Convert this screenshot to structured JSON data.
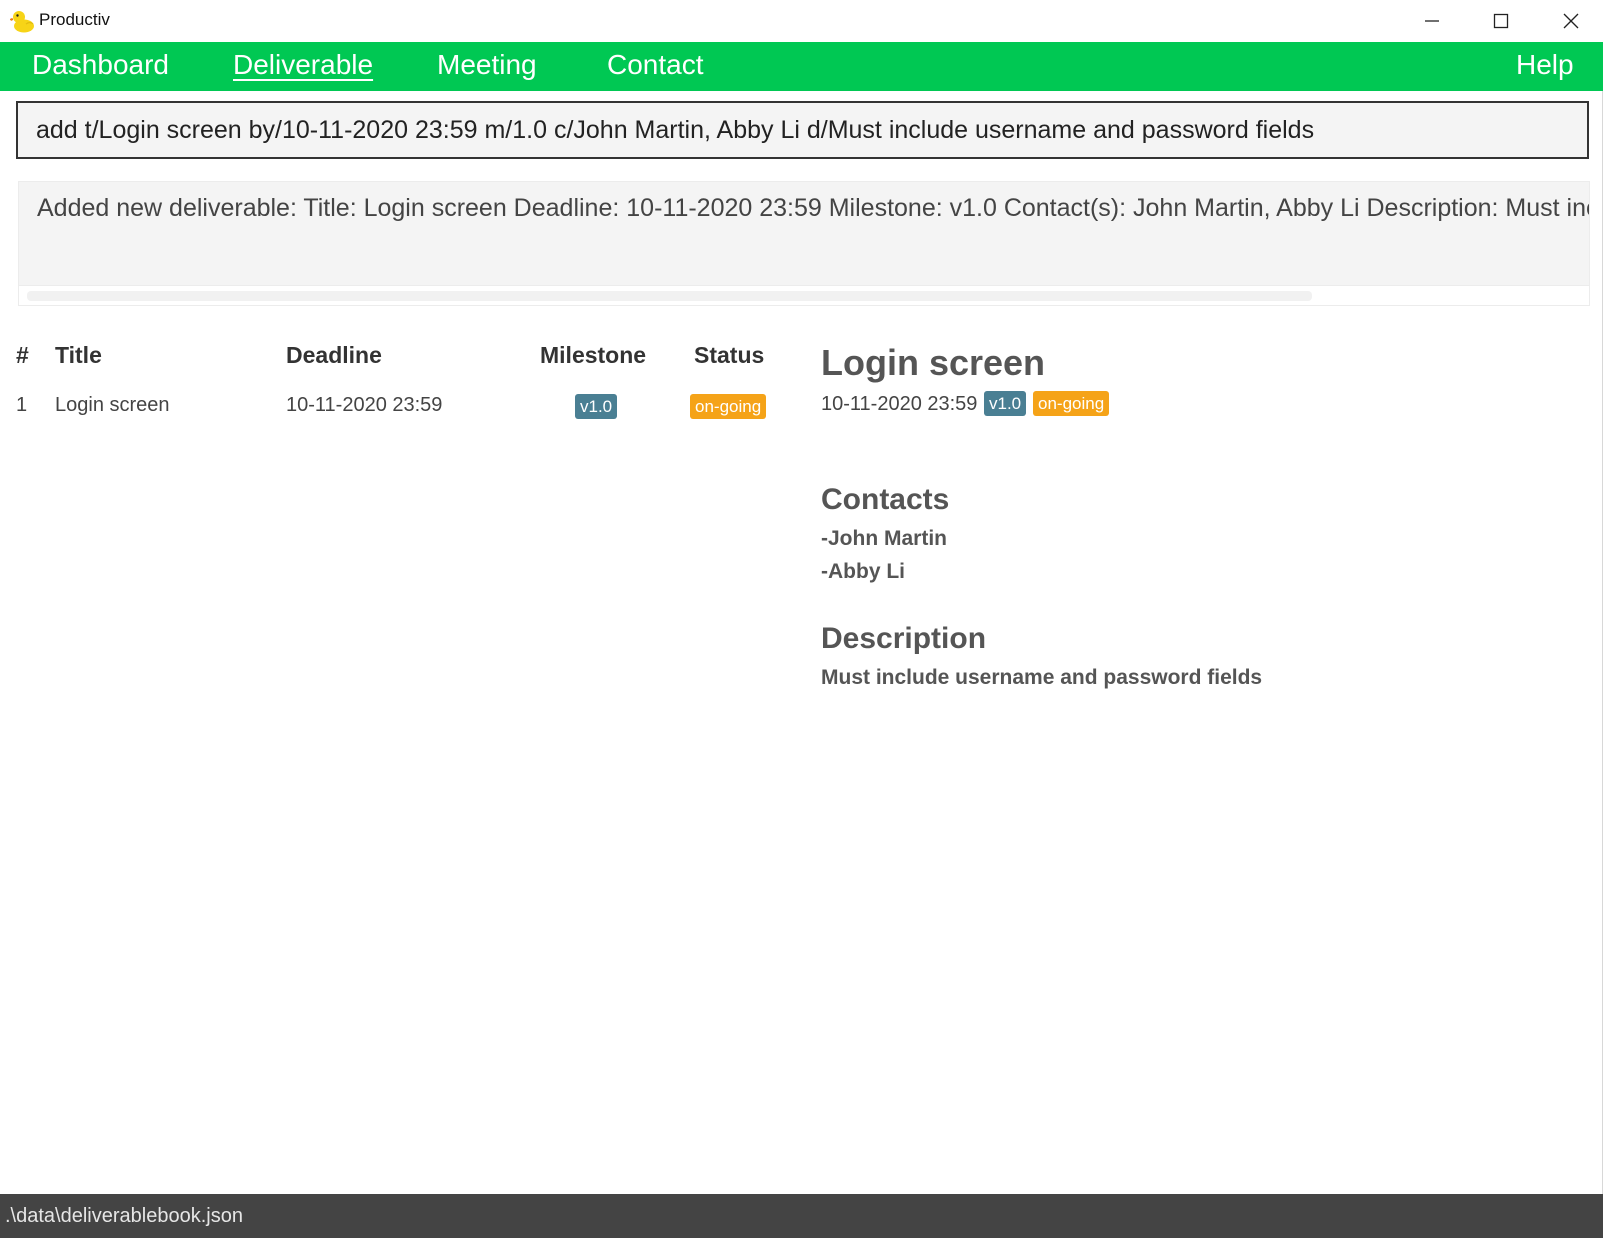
{
  "window": {
    "title": "Productiv",
    "icon": "rubber-duck-icon"
  },
  "menu": {
    "items": [
      {
        "label": "Dashboard",
        "active": false
      },
      {
        "label": "Deliverable",
        "active": true
      },
      {
        "label": "Meeting",
        "active": false
      },
      {
        "label": "Contact",
        "active": false
      }
    ],
    "help": "Help"
  },
  "command": {
    "value": "add t/Login screen by/10-11-2020 23:59 m/1.0 c/John Martin, Abby Li d/Must include username and password fields"
  },
  "result": {
    "text": "Added new deliverable: Title: Login screen Deadline: 10-11-2020 23:59 Milestone: v1.0 Contact(s): John Martin, Abby Li Description: Must include username and password fields"
  },
  "table": {
    "headers": {
      "num": "#",
      "title": "Title",
      "deadline": "Deadline",
      "milestone": "Milestone",
      "status": "Status"
    },
    "rows": [
      {
        "num": "1",
        "title": "Login screen",
        "deadline": "10-11-2020 23:59",
        "milestone": "v1.0",
        "status": "on-going"
      }
    ]
  },
  "detail": {
    "title": "Login screen",
    "deadline": "10-11-2020 23:59",
    "milestone": "v1.0",
    "status": "on-going",
    "contacts_heading": "Contacts",
    "contacts": [
      "-John Martin",
      "-Abby Li"
    ],
    "description_heading": "Description",
    "description": "Must include username and password fields"
  },
  "statusbar": {
    "path": ".\\data\\deliverablebook.json"
  },
  "colors": {
    "menu_bg": "#00c853",
    "milestone_badge": "#4a7f93",
    "status_badge": "#f5a318",
    "statusbar_bg": "#444444"
  }
}
